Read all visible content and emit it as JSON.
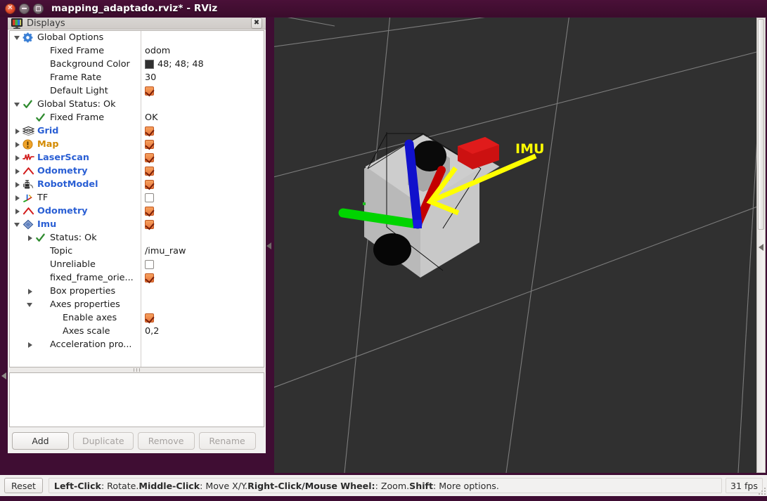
{
  "window": {
    "title": "mapping_adaptado.rviz* - RViz",
    "controls": {
      "close": "×",
      "minimize": "minimize",
      "maximize": "maximize"
    }
  },
  "displays_panel": {
    "title": "Displays",
    "icon": "displays-icon",
    "close_label": "✖",
    "tree": [
      {
        "indent": 0,
        "arrow": "down",
        "icon": "gear-icon",
        "label": "Global Options",
        "style": "plain",
        "value_type": "none"
      },
      {
        "indent": 1,
        "arrow": "none",
        "icon": "none",
        "label": "Fixed Frame",
        "style": "plain",
        "value_type": "text",
        "value": "odom"
      },
      {
        "indent": 1,
        "arrow": "none",
        "icon": "none",
        "label": "Background Color",
        "style": "plain",
        "value_type": "color",
        "value": "48; 48; 48",
        "color": "#303030"
      },
      {
        "indent": 1,
        "arrow": "none",
        "icon": "none",
        "label": "Frame Rate",
        "style": "plain",
        "value_type": "text",
        "value": "30"
      },
      {
        "indent": 1,
        "arrow": "none",
        "icon": "none",
        "label": "Default Light",
        "style": "plain",
        "value_type": "checkbox",
        "checked": true
      },
      {
        "indent": 0,
        "arrow": "down",
        "icon": "check-green-icon",
        "label": "Global Status: Ok",
        "style": "plain",
        "value_type": "none"
      },
      {
        "indent": 1,
        "arrow": "none",
        "icon": "check-green-icon",
        "label": "Fixed Frame",
        "style": "plain",
        "value_type": "text",
        "value": "OK"
      },
      {
        "indent": 0,
        "arrow": "right",
        "icon": "grid-icon",
        "label": "Grid",
        "style": "blue",
        "value_type": "checkbox",
        "checked": true
      },
      {
        "indent": 0,
        "arrow": "right",
        "icon": "map-warning-icon",
        "label": "Map",
        "style": "orange",
        "value_type": "checkbox",
        "checked": true
      },
      {
        "indent": 0,
        "arrow": "right",
        "icon": "laserscan-icon",
        "label": "LaserScan",
        "style": "blue",
        "value_type": "checkbox",
        "checked": true
      },
      {
        "indent": 0,
        "arrow": "right",
        "icon": "odometry-icon",
        "label": "Odometry",
        "style": "blue",
        "value_type": "checkbox",
        "checked": true
      },
      {
        "indent": 0,
        "arrow": "right",
        "icon": "robotmodel-icon",
        "label": "RobotModel",
        "style": "blue",
        "value_type": "checkbox",
        "checked": true
      },
      {
        "indent": 0,
        "arrow": "right",
        "icon": "tf-icon",
        "label": "TF",
        "style": "plain",
        "value_type": "checkbox",
        "checked": false
      },
      {
        "indent": 0,
        "arrow": "right",
        "icon": "odometry-icon",
        "label": "Odometry",
        "style": "blue",
        "value_type": "checkbox",
        "checked": true
      },
      {
        "indent": 0,
        "arrow": "down",
        "icon": "imu-icon",
        "label": "Imu",
        "style": "blue",
        "value_type": "checkbox",
        "checked": true
      },
      {
        "indent": 1,
        "arrow": "right",
        "icon": "check-green-icon",
        "label": "Status: Ok",
        "style": "plain",
        "value_type": "none"
      },
      {
        "indent": 1,
        "arrow": "none",
        "icon": "none",
        "label": "Topic",
        "style": "plain",
        "value_type": "text",
        "value": "/imu_raw"
      },
      {
        "indent": 1,
        "arrow": "none",
        "icon": "none",
        "label": "Unreliable",
        "style": "plain",
        "value_type": "checkbox",
        "checked": false
      },
      {
        "indent": 1,
        "arrow": "none",
        "icon": "none",
        "label": "fixed_frame_orie...",
        "style": "plain",
        "value_type": "checkbox",
        "checked": true
      },
      {
        "indent": 1,
        "arrow": "right",
        "icon": "none",
        "label": "Box properties",
        "style": "plain",
        "value_type": "none"
      },
      {
        "indent": 1,
        "arrow": "down",
        "icon": "none",
        "label": "Axes properties",
        "style": "plain",
        "value_type": "none"
      },
      {
        "indent": 2,
        "arrow": "none",
        "icon": "none",
        "label": "Enable axes",
        "style": "plain",
        "value_type": "checkbox",
        "checked": true
      },
      {
        "indent": 2,
        "arrow": "none",
        "icon": "none",
        "label": "Axes scale",
        "style": "plain",
        "value_type": "text",
        "value": "0,2"
      },
      {
        "indent": 1,
        "arrow": "right",
        "icon": "none",
        "label": "Acceleration pro...",
        "style": "plain",
        "value_type": "none"
      }
    ],
    "buttons": [
      {
        "label": "Add",
        "enabled": true
      },
      {
        "label": "Duplicate",
        "enabled": false
      },
      {
        "label": "Remove",
        "enabled": false
      },
      {
        "label": "Rename",
        "enabled": false
      }
    ]
  },
  "view3d": {
    "background_color": "#303030",
    "grid_color": "#9a9a9a",
    "annotation": {
      "label": "IMU",
      "color": "#ffff00"
    },
    "axes": {
      "x_color": "#cc0000",
      "y_color": "#00dd00",
      "z_color": "#0000dd"
    },
    "robot": {
      "body_color": "#c8c8c8",
      "sensor_color": "#cc1111",
      "wheel_color": "#000000"
    }
  },
  "statusbar": {
    "reset_label": "Reset",
    "hint_parts": [
      {
        "text": "Left-Click",
        "bold": true
      },
      {
        "text": ": Rotate. ",
        "bold": false
      },
      {
        "text": "Middle-Click",
        "bold": true
      },
      {
        "text": ": Move X/Y. ",
        "bold": false
      },
      {
        "text": "Right-Click/Mouse Wheel:",
        "bold": true
      },
      {
        "text": ": Zoom. ",
        "bold": false
      },
      {
        "text": "Shift",
        "bold": true
      },
      {
        "text": ": More options.",
        "bold": false
      }
    ],
    "fps": "31 fps"
  }
}
